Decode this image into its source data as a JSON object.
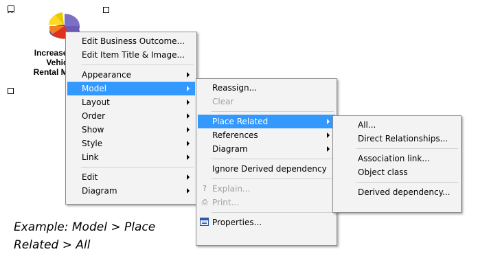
{
  "node": {
    "label_lines": [
      "Increase Avis",
      "Vehicle",
      "Rental Market"
    ],
    "icon": "pie-chart-icon"
  },
  "menu_main": {
    "items": [
      {
        "label": "Edit Business Outcome..."
      },
      {
        "label": "Edit Item Title & Image..."
      },
      {
        "label": "Appearance",
        "submenu": true
      },
      {
        "label": "Model",
        "submenu": true,
        "selected": true
      },
      {
        "label": "Layout",
        "submenu": true
      },
      {
        "label": "Order",
        "submenu": true
      },
      {
        "label": "Show",
        "submenu": true
      },
      {
        "label": "Style",
        "submenu": true
      },
      {
        "label": "Link",
        "submenu": true
      },
      {
        "label": "Edit",
        "submenu": true
      },
      {
        "label": "Diagram",
        "submenu": true
      }
    ]
  },
  "menu_model": {
    "items": [
      {
        "label": "Reassign..."
      },
      {
        "label": "Clear",
        "disabled": true
      },
      {
        "label": "Place Related",
        "submenu": true,
        "selected": true
      },
      {
        "label": "References",
        "submenu": true
      },
      {
        "label": "Diagram",
        "submenu": true
      },
      {
        "label": "Ignore Derived dependency"
      },
      {
        "label": "Explain...",
        "disabled": true,
        "icon": "question-icon"
      },
      {
        "label": "Print...",
        "disabled": true,
        "icon": "print-icon"
      },
      {
        "label": "Properties...",
        "icon": "properties-icon"
      }
    ]
  },
  "menu_place_related": {
    "items": [
      {
        "label": "All..."
      },
      {
        "label": "Direct Relationships..."
      },
      {
        "label": "Association link..."
      },
      {
        "label": "Object class"
      },
      {
        "label": "Derived dependency..."
      }
    ]
  },
  "caption": {
    "line1": "Example: Model > Place",
    "line2": "Related > All"
  },
  "colors": {
    "selection": "#3399ff",
    "menu_bg": "#f3f3f3"
  }
}
